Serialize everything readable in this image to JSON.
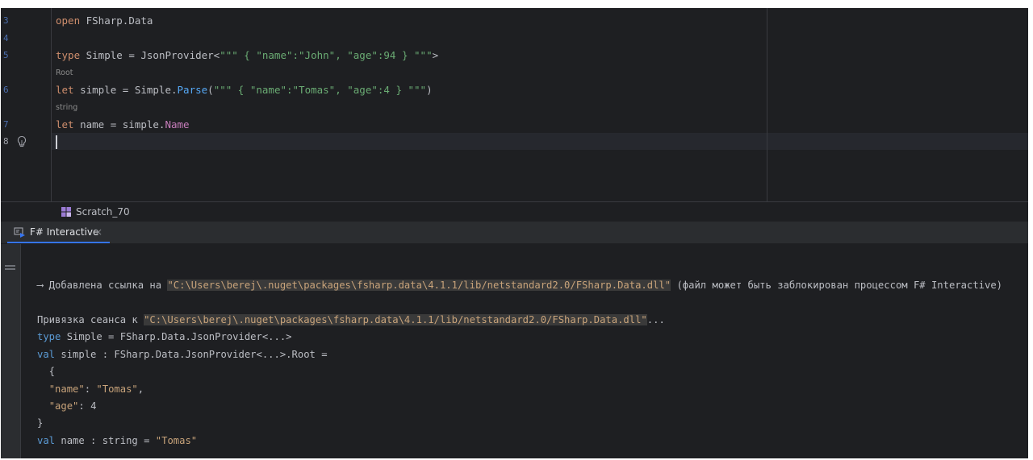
{
  "editor": {
    "line_numbers": [
      "3",
      "4",
      "5",
      "6",
      "7",
      "8"
    ],
    "lines": {
      "l3": {
        "kw": "open",
        "rest": " FSharp.Data"
      },
      "l5": {
        "kw": "type",
        "a": " Simple = JsonProvider<",
        "str": "\"\"\" { \"name\":\"John\", \"age\":94 } \"\"\"",
        "b": ">"
      },
      "l6": {
        "kw": "let",
        "a": " simple = Simple.",
        "method": "Parse",
        "b": "(",
        "str": "\"\"\" { \"name\":\"Tomas\", \"age\":4 } \"\"\"",
        "c": ")"
      },
      "l7": {
        "kw": "let",
        "a": " name = simple.",
        "prop": "Name"
      }
    },
    "hints": {
      "root": "Root",
      "string": "string"
    }
  },
  "breadcrumb": {
    "label": "Scratch_70"
  },
  "tool_window": {
    "tab_label": "F# Interactive",
    "close_glyph": "×"
  },
  "console": {
    "line1": {
      "arrow": "⟶ Добавлена ссылка на ",
      "path": "\"C:\\Users\\berej\\.nuget\\packages\\fsharp.data\\4.1.1/lib/netstandard2.0/FSharp.Data.dll\"",
      "suffix": " (файл может быть заблокирован процессом F# Interactive)"
    },
    "line2": {
      "prefix": "Привязка сеанса к ",
      "path": "\"C:\\Users\\berej\\.nuget\\packages\\fsharp.data\\4.1.1/lib/netstandard2.0/FSharp.Data.dll\"",
      "suffix": "..."
    },
    "line3": {
      "kw": "type",
      "rest": " Simple = FSharp.Data.JsonProvider<...>"
    },
    "line4": {
      "kw": "val",
      "rest": " simple : FSharp.Data.JsonProvider<...>.Root ="
    },
    "line5": "  {",
    "line6": {
      "indent": "  ",
      "key": "\"name\"",
      "sep": ": ",
      "value": "\"Tomas\"",
      "end": ","
    },
    "line7": {
      "indent": "  ",
      "key": "\"age\"",
      "sep": ": ",
      "value": "4"
    },
    "line8": "}",
    "line9": {
      "kw": "val",
      "rest": " name : string = ",
      "value": "\"Tomas\""
    }
  },
  "colors": {
    "editor_bg": "#1e1f22",
    "keyword": "#cf8e6d",
    "string": "#6aab73",
    "method": "#56a8f5",
    "property": "#c77dbb",
    "console_string": "#c8a37a",
    "console_keyword": "#5b9bd5",
    "accent": "#3574f0"
  },
  "icons": {
    "bulb": "lightbulb-icon",
    "scratch": "scratch-file-icon",
    "fsi": "fsharp-interactive-icon",
    "menu": "hamburger-menu-icon"
  }
}
